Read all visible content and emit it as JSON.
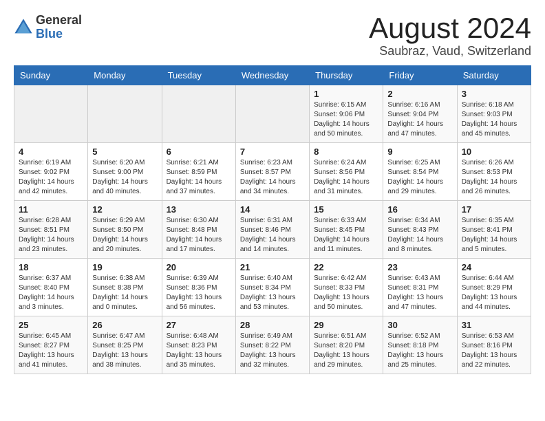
{
  "logo": {
    "general": "General",
    "blue": "Blue"
  },
  "title": {
    "month_year": "August 2024",
    "location": "Saubraz, Vaud, Switzerland"
  },
  "weekdays": [
    "Sunday",
    "Monday",
    "Tuesday",
    "Wednesday",
    "Thursday",
    "Friday",
    "Saturday"
  ],
  "weeks": [
    [
      {
        "day": "",
        "empty": true
      },
      {
        "day": "",
        "empty": true
      },
      {
        "day": "",
        "empty": true
      },
      {
        "day": "",
        "empty": true
      },
      {
        "day": "1",
        "sunrise": "6:15 AM",
        "sunset": "9:06 PM",
        "daylight": "14 hours and 50 minutes."
      },
      {
        "day": "2",
        "sunrise": "6:16 AM",
        "sunset": "9:04 PM",
        "daylight": "14 hours and 47 minutes."
      },
      {
        "day": "3",
        "sunrise": "6:18 AM",
        "sunset": "9:03 PM",
        "daylight": "14 hours and 45 minutes."
      }
    ],
    [
      {
        "day": "4",
        "sunrise": "6:19 AM",
        "sunset": "9:02 PM",
        "daylight": "14 hours and 42 minutes."
      },
      {
        "day": "5",
        "sunrise": "6:20 AM",
        "sunset": "9:00 PM",
        "daylight": "14 hours and 40 minutes."
      },
      {
        "day": "6",
        "sunrise": "6:21 AM",
        "sunset": "8:59 PM",
        "daylight": "14 hours and 37 minutes."
      },
      {
        "day": "7",
        "sunrise": "6:23 AM",
        "sunset": "8:57 PM",
        "daylight": "14 hours and 34 minutes."
      },
      {
        "day": "8",
        "sunrise": "6:24 AM",
        "sunset": "8:56 PM",
        "daylight": "14 hours and 31 minutes."
      },
      {
        "day": "9",
        "sunrise": "6:25 AM",
        "sunset": "8:54 PM",
        "daylight": "14 hours and 29 minutes."
      },
      {
        "day": "10",
        "sunrise": "6:26 AM",
        "sunset": "8:53 PM",
        "daylight": "14 hours and 26 minutes."
      }
    ],
    [
      {
        "day": "11",
        "sunrise": "6:28 AM",
        "sunset": "8:51 PM",
        "daylight": "14 hours and 23 minutes."
      },
      {
        "day": "12",
        "sunrise": "6:29 AM",
        "sunset": "8:50 PM",
        "daylight": "14 hours and 20 minutes."
      },
      {
        "day": "13",
        "sunrise": "6:30 AM",
        "sunset": "8:48 PM",
        "daylight": "14 hours and 17 minutes."
      },
      {
        "day": "14",
        "sunrise": "6:31 AM",
        "sunset": "8:46 PM",
        "daylight": "14 hours and 14 minutes."
      },
      {
        "day": "15",
        "sunrise": "6:33 AM",
        "sunset": "8:45 PM",
        "daylight": "14 hours and 11 minutes."
      },
      {
        "day": "16",
        "sunrise": "6:34 AM",
        "sunset": "8:43 PM",
        "daylight": "14 hours and 8 minutes."
      },
      {
        "day": "17",
        "sunrise": "6:35 AM",
        "sunset": "8:41 PM",
        "daylight": "14 hours and 5 minutes."
      }
    ],
    [
      {
        "day": "18",
        "sunrise": "6:37 AM",
        "sunset": "8:40 PM",
        "daylight": "14 hours and 3 minutes."
      },
      {
        "day": "19",
        "sunrise": "6:38 AM",
        "sunset": "8:38 PM",
        "daylight": "14 hours and 0 minutes."
      },
      {
        "day": "20",
        "sunrise": "6:39 AM",
        "sunset": "8:36 PM",
        "daylight": "13 hours and 56 minutes."
      },
      {
        "day": "21",
        "sunrise": "6:40 AM",
        "sunset": "8:34 PM",
        "daylight": "13 hours and 53 minutes."
      },
      {
        "day": "22",
        "sunrise": "6:42 AM",
        "sunset": "8:33 PM",
        "daylight": "13 hours and 50 minutes."
      },
      {
        "day": "23",
        "sunrise": "6:43 AM",
        "sunset": "8:31 PM",
        "daylight": "13 hours and 47 minutes."
      },
      {
        "day": "24",
        "sunrise": "6:44 AM",
        "sunset": "8:29 PM",
        "daylight": "13 hours and 44 minutes."
      }
    ],
    [
      {
        "day": "25",
        "sunrise": "6:45 AM",
        "sunset": "8:27 PM",
        "daylight": "13 hours and 41 minutes."
      },
      {
        "day": "26",
        "sunrise": "6:47 AM",
        "sunset": "8:25 PM",
        "daylight": "13 hours and 38 minutes."
      },
      {
        "day": "27",
        "sunrise": "6:48 AM",
        "sunset": "8:23 PM",
        "daylight": "13 hours and 35 minutes."
      },
      {
        "day": "28",
        "sunrise": "6:49 AM",
        "sunset": "8:22 PM",
        "daylight": "13 hours and 32 minutes."
      },
      {
        "day": "29",
        "sunrise": "6:51 AM",
        "sunset": "8:20 PM",
        "daylight": "13 hours and 29 minutes."
      },
      {
        "day": "30",
        "sunrise": "6:52 AM",
        "sunset": "8:18 PM",
        "daylight": "13 hours and 25 minutes."
      },
      {
        "day": "31",
        "sunrise": "6:53 AM",
        "sunset": "8:16 PM",
        "daylight": "13 hours and 22 minutes."
      }
    ]
  ]
}
